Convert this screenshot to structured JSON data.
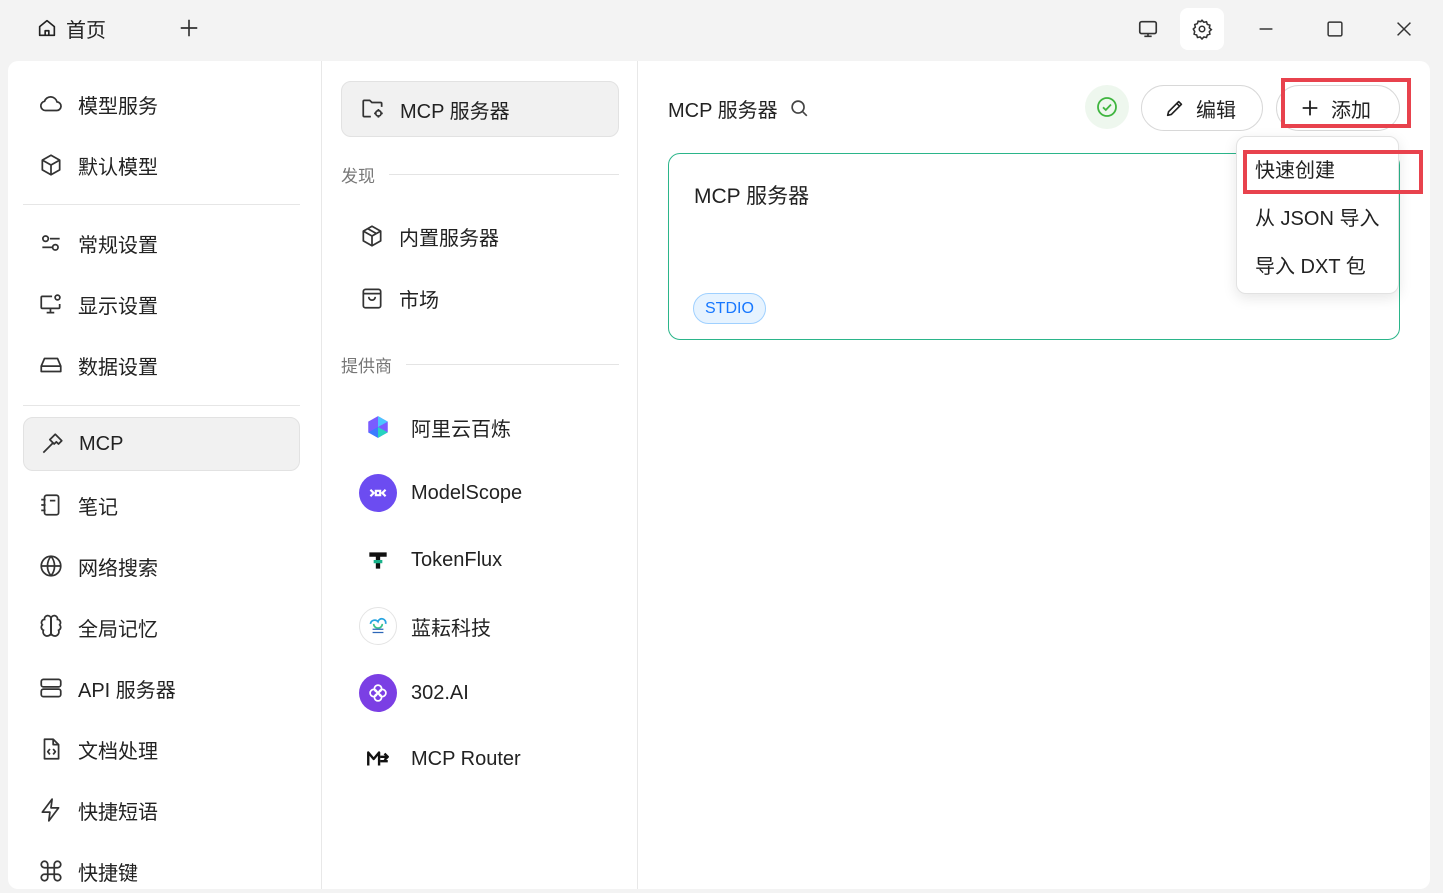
{
  "titlebar": {
    "tab_home_label": "首页",
    "icons": [
      "home-icon",
      "plus-icon",
      "monitor-icon",
      "gear-icon",
      "minimize-icon",
      "maximize-icon",
      "close-icon"
    ]
  },
  "sidebar": {
    "items": [
      {
        "label": "模型服务",
        "icon": "cloud-icon"
      },
      {
        "label": "默认模型",
        "icon": "cube-icon"
      },
      {
        "label": "常规设置",
        "icon": "sliders-icon"
      },
      {
        "label": "显示设置",
        "icon": "display-settings-icon"
      },
      {
        "label": "数据设置",
        "icon": "drive-icon"
      },
      {
        "label": "MCP",
        "icon": "hammer-icon",
        "active": true
      },
      {
        "label": "笔记",
        "icon": "notebook-icon"
      },
      {
        "label": "网络搜索",
        "icon": "globe-icon"
      },
      {
        "label": "全局记忆",
        "icon": "brain-icon"
      },
      {
        "label": "API 服务器",
        "icon": "server-icon"
      },
      {
        "label": "文档处理",
        "icon": "document-code-icon"
      },
      {
        "label": "快捷短语",
        "icon": "zap-icon"
      },
      {
        "label": "快捷键",
        "icon": "command-icon"
      }
    ]
  },
  "subnav": {
    "header_label": "MCP 服务器",
    "discover_title": "发现",
    "discover_items": [
      {
        "label": "内置服务器",
        "icon": "package-icon"
      },
      {
        "label": "市场",
        "icon": "shopping-bag-icon"
      }
    ],
    "providers_title": "提供商",
    "providers": [
      {
        "label": "阿里云百炼",
        "icon": "bailian-logo"
      },
      {
        "label": "ModelScope",
        "icon": "modelscope-logo"
      },
      {
        "label": "TokenFlux",
        "icon": "tokenflux-logo"
      },
      {
        "label": "蓝耘科技",
        "icon": "lanyun-logo"
      },
      {
        "label": "302.AI",
        "icon": "302ai-logo"
      },
      {
        "label": "MCP Router",
        "icon": "mcp-router-logo"
      }
    ]
  },
  "content": {
    "title": "MCP 服务器",
    "edit_label": "编辑",
    "add_label": "添加",
    "card": {
      "title": "MCP 服务器",
      "badge": "STDIO"
    }
  },
  "dropdown": {
    "items": [
      "快速创建",
      "从 JSON 导入",
      "导入 DXT 包"
    ]
  },
  "colors": {
    "accent_green": "#2bb58a",
    "badge_blue": "#1677ff",
    "highlight_red": "#e8424d"
  }
}
